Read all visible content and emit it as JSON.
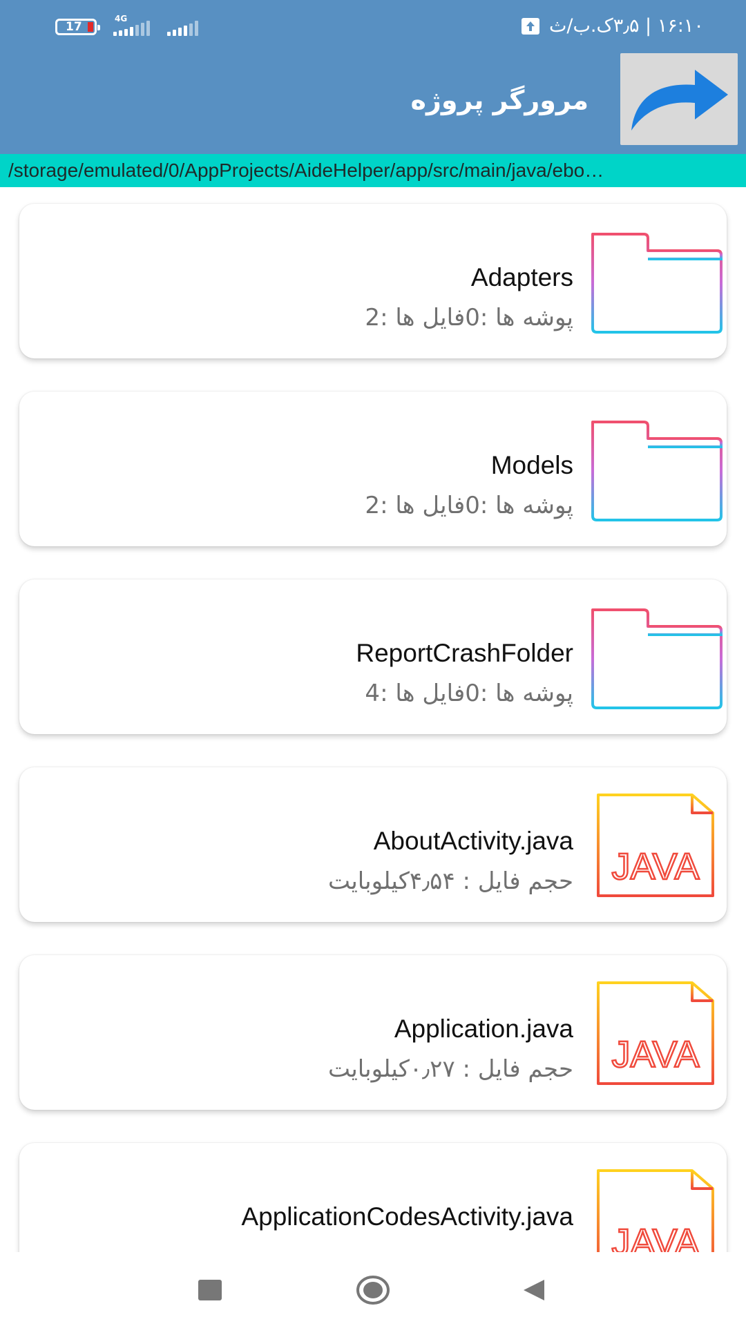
{
  "status_bar": {
    "battery_level": "17",
    "network_type": "4G",
    "status_text": "۱۶:۱۰ | ۳٫۵ک.ب/ث",
    "icons": [
      "battery-icon",
      "signal-icon",
      "upload-icon"
    ]
  },
  "toolbar": {
    "title": "مرورگر پروژه",
    "share_icon": "share-arrow-icon"
  },
  "path": "/storage/emulated/0/AppProjects/AideHelper/app/src/main/java/ebo…",
  "items": [
    {
      "name": "Adapters",
      "meta": "پوشه ها :0فایل ها :2",
      "icon": "folder-icon"
    },
    {
      "name": "Models",
      "meta": "پوشه ها :0فایل ها :2",
      "icon": "folder-icon"
    },
    {
      "name": "ReportCrashFolder",
      "meta": "پوشه ها :0فایل ها :4",
      "icon": "folder-icon"
    },
    {
      "name": "AboutActivity.java",
      "meta": "حجم فایل : ۴٫۵۴کیلوبایت",
      "icon": "java-file-icon"
    },
    {
      "name": "Application.java",
      "meta": "حجم فایل : ۰٫۲۷کیلوبایت",
      "icon": "java-file-icon"
    },
    {
      "name": "ApplicationCodesActivity.java",
      "meta": "",
      "icon": "java-file-icon"
    }
  ],
  "java_icon_text": "JAVA",
  "colors": {
    "toolbar": "#5890c2",
    "path_bar": "#00d4c8",
    "folder_gradient_top": "#f0506e",
    "folder_gradient_bottom": "#22c4e8",
    "java_gradient_top": "#ffd21f",
    "java_gradient_bottom": "#f04a3c"
  },
  "nav": {
    "icons": [
      "recents-icon",
      "home-icon",
      "back-icon"
    ]
  }
}
